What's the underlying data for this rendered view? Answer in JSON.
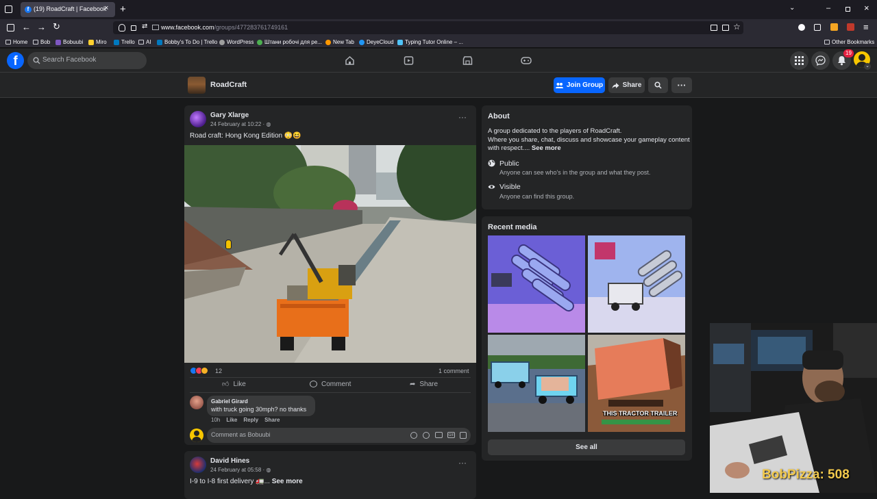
{
  "browser": {
    "tab_title": "(19) RoadCraft | Facebook",
    "url_host": "www.facebook.com",
    "url_path": "/groups/477283761749161",
    "bookmarks": [
      "Home",
      "Bob",
      "Bobuubi",
      "Miro",
      "Trello",
      "AI",
      "Bobby's To Do | Trello",
      "WordPress",
      "Штани робочі для ре...",
      "New Tab",
      "DeyeCloud",
      "Typing Tutor Online – ..."
    ],
    "other_bookmarks": "Other Bookmarks"
  },
  "header": {
    "search_placeholder": "Search Facebook",
    "notification_count": "19"
  },
  "group": {
    "name": "RoadCraft",
    "join_label": "Join Group",
    "share_label": "Share"
  },
  "post1": {
    "author": "Gary Xlarge",
    "time": "24 February at 10:22 · ",
    "text": "Road craft: Hong Kong Edition 😳😆",
    "reaction_count": "12",
    "comment_count": "1 comment",
    "like": "Like",
    "comment": "Comment",
    "share": "Share",
    "comment_item": {
      "author": "Gabriel Girard",
      "text": "with truck going 30mph? no thanks",
      "age": "10h",
      "like": "Like",
      "reply": "Reply",
      "share": "Share"
    },
    "comment_placeholder": "Comment as Bobuubi"
  },
  "post2": {
    "author": "David Hines",
    "time": "24 February at 05:58 · ",
    "text": "I-9 to I-8 first delivery 🚛... ",
    "see_more": "See more"
  },
  "about": {
    "title": "About",
    "desc1": "A group dedicated to the players of RoadCraft.",
    "desc2": "Where you share, chat, discuss and showcase your gameplay content",
    "desc3": "with respect.... ",
    "see_more": "See more",
    "public_title": "Public",
    "public_desc": "Anyone can see who's in the group and what they post.",
    "visible_title": "Visible",
    "visible_desc": "Anyone can find this group."
  },
  "media": {
    "title": "Recent media",
    "thumb4_caption": "THIS TRACTOR TRAILER",
    "see_all": "See all"
  },
  "overlay": {
    "counter": "BobPizza: 508"
  },
  "colors": {
    "accent": "#0866ff",
    "background": "#18191a",
    "card": "#242526",
    "notification": "#e41e3f"
  }
}
